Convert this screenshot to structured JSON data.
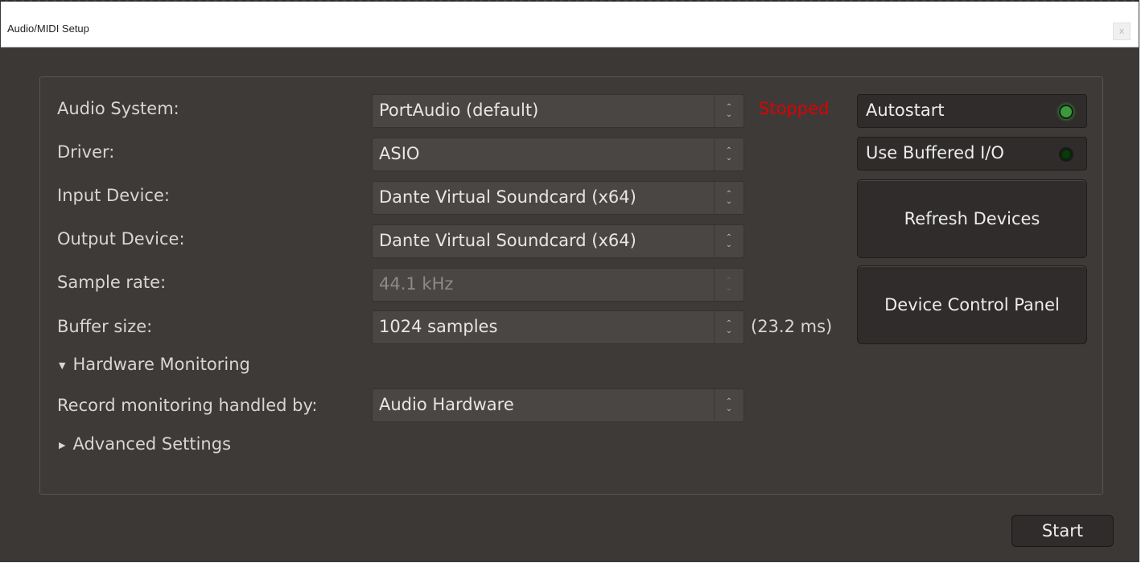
{
  "window": {
    "title": "Audio/MIDI Setup",
    "close_label": "x"
  },
  "fields": {
    "audio_system": {
      "label": "Audio System:",
      "value": "PortAudio (default)"
    },
    "driver": {
      "label": "Driver:",
      "value": "ASIO"
    },
    "input_device": {
      "label": "Input Device:",
      "value": "Dante Virtual Soundcard (x64)"
    },
    "output_device": {
      "label": "Output Device:",
      "value": "Dante Virtual Soundcard (x64)"
    },
    "sample_rate": {
      "label": "Sample rate:",
      "value": "44.1 kHz"
    },
    "buffer_size": {
      "label": "Buffer size:",
      "value": "1024 samples"
    },
    "record_monitoring": {
      "label": "Record monitoring handled by:",
      "value": "Audio Hardware"
    }
  },
  "status": {
    "text": "Stopped",
    "color": "#e00000"
  },
  "latency": "(23.2 ms)",
  "toggles": {
    "autostart": {
      "label": "Autostart",
      "on": true
    },
    "buffered_io": {
      "label": "Use Buffered I/O",
      "on": false
    }
  },
  "buttons": {
    "refresh": "Refresh Devices",
    "device_control": "Device Control Panel",
    "start": "Start"
  },
  "expanders": {
    "hardware_monitoring": {
      "label": "Hardware Monitoring",
      "expanded": true
    },
    "advanced_settings": {
      "label": "Advanced Settings",
      "expanded": false
    }
  },
  "icons": {
    "combo_arrows": "up-down-chevron-icon",
    "expanded": "triangle-down-icon",
    "collapsed": "triangle-right-icon",
    "led": "led-indicator-icon"
  },
  "colors": {
    "background": "#3b3836",
    "led_on": "#3a9a3a",
    "led_off": "#0c3a0c"
  }
}
